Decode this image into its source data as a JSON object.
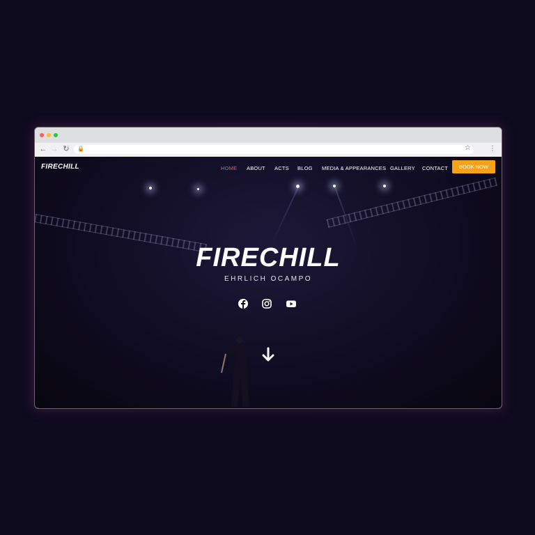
{
  "site": {
    "logo": "FIRECHILL",
    "nav": [
      {
        "label": "HOME",
        "active": true
      },
      {
        "label": "ABOUT",
        "active": false
      },
      {
        "label": "ACTS",
        "active": false
      },
      {
        "label": "BLOG",
        "active": false
      },
      {
        "label": "MEDIA & APPEARANCES",
        "active": false
      },
      {
        "label": "GALLERY",
        "active": false
      },
      {
        "label": "CONTACT",
        "active": false
      }
    ],
    "book_label": "BOOK NOW"
  },
  "hero": {
    "title": "FIRECHILL",
    "subtitle": "EHRLICH OCAMPO",
    "social": [
      "facebook-icon",
      "instagram-icon",
      "youtube-icon"
    ],
    "scroll_icon": "arrow-down-icon"
  },
  "colors": {
    "accent": "#f7a21b",
    "active_nav": "#e8586e",
    "page_bg": "#0f0b1f"
  }
}
